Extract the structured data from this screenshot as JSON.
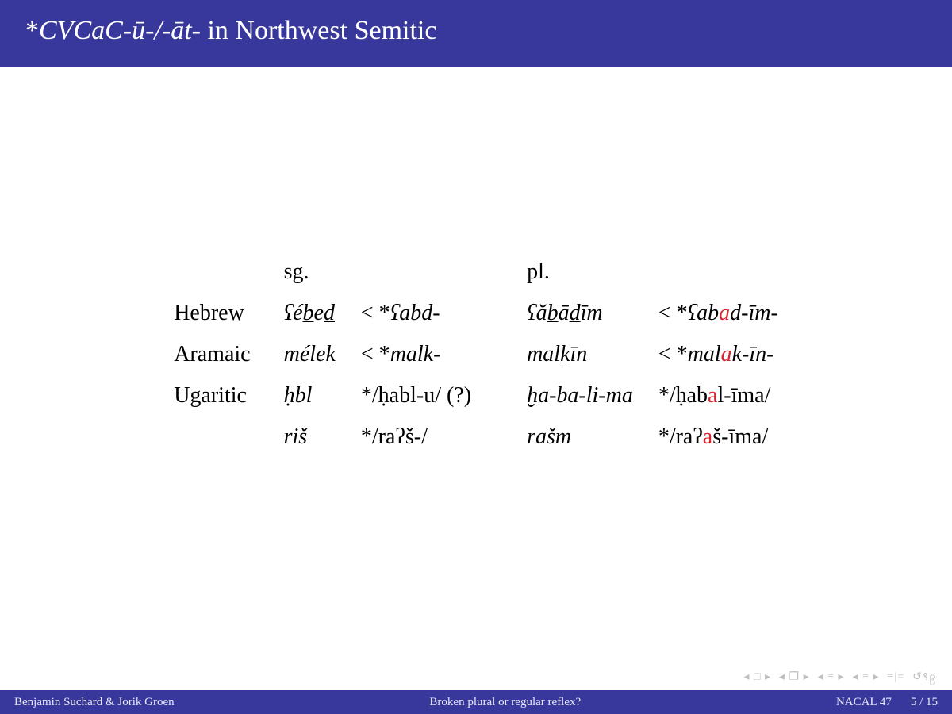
{
  "title": {
    "prefix": "*",
    "pattern": "CVCaC-ū-/-āt-",
    "suffix": " in Northwest Semitic"
  },
  "headers": {
    "sg": "sg.",
    "pl": "pl."
  },
  "rows": {
    "hebrew": {
      "lang": "Hebrew",
      "sg_form_pre": "ʕé",
      "sg_form_u1": "b",
      "sg_form_mid": "e",
      "sg_form_u2": "d",
      "sg_etym": "< *ʕabd-",
      "pl_form_pre": "ʕă",
      "pl_form_u1": "b",
      "pl_form_mid1": "ā",
      "pl_form_u2": "d",
      "pl_form_post": "īm",
      "pl_etym_pre": "< *ʕab",
      "pl_etym_red": "a",
      "pl_etym_post": "d-īm-"
    },
    "aramaic": {
      "lang": "Aramaic",
      "sg_form_pre": "méle",
      "sg_form_u1": "k",
      "sg_etym": "< *malk-",
      "pl_form_pre": "mal",
      "pl_form_u1": "k",
      "pl_form_post": "īn",
      "pl_etym_pre": "< *mal",
      "pl_etym_red": "a",
      "pl_etym_post": "k-īn-"
    },
    "ugaritic1": {
      "lang": "Ugaritic",
      "sg_form": "ḥbl",
      "sg_etym": "*/ḥabl-u/ (?)",
      "pl_form": "ḫa-ba-li-ma",
      "pl_etym_pre": "*/ḥab",
      "pl_etym_red": "a",
      "pl_etym_post": "l-īma/"
    },
    "ugaritic2": {
      "sg_form": "riš",
      "sg_etym": "*/raʔš-/",
      "pl_form": "rašm",
      "pl_etym_pre": "*/raʔ",
      "pl_etym_red": "a",
      "pl_etym_post": "š-īma/"
    }
  },
  "nav": {
    "first": "◂ □ ▸",
    "sub": "◂ ❐ ▸",
    "prev": "◂ ≡ ▸",
    "next": "◂ ≡ ▸",
    "mode": "≡|=",
    "cycle": "↺९၉"
  },
  "footer": {
    "authors": "Benjamin Suchard & Jorik Groen",
    "title": "Broken plural or regular reflex?",
    "venue": "NACAL 47",
    "page": "5 / 15"
  }
}
